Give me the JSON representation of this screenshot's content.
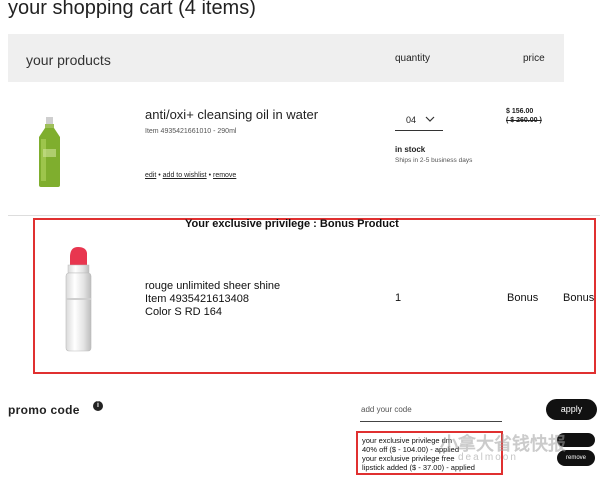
{
  "cart": {
    "title": "your shopping cart (4 items)"
  },
  "header": {
    "products": "your products",
    "quantity": "quantity",
    "price": "price"
  },
  "product1": {
    "name": "anti/oxi+ cleansing oil in water",
    "item": "Item 4935421661010 - 290ml",
    "quantity": "04",
    "stock": "in stock",
    "ships": "Ships in 2-5 business days",
    "price": "$ 156.00",
    "original_price": "( $ 260.00 )",
    "links": {
      "edit": "edit",
      "sep1": "•",
      "wishlist": "add to wishlist",
      "sep2": "•",
      "remove": "remove"
    }
  },
  "bonus": {
    "title": "Your exclusive privilege : Bonus Product",
    "name": "rouge unlimited sheer shine",
    "item": "Item 4935421613408",
    "color": "Color S RD 164",
    "quantity": "1",
    "price1": "Bonus",
    "price2": "Bonus"
  },
  "promo": {
    "label": "promo code",
    "info_icon": "i",
    "placeholder": "add your code",
    "apply": "apply",
    "applied": [
      "your exclusive privilege dm",
      "40% off ($ - 104.00) - applied",
      "your exclusive privilege free",
      "lipstick added ($ - 37.00) - applied"
    ],
    "remove": "remove"
  },
  "watermark": {
    "line1": "小拿大省钱快报",
    "line2": "dealmoon"
  },
  "colors": {
    "accent_red": "#e03030",
    "button_black": "#111111",
    "header_bg": "#efefef"
  }
}
